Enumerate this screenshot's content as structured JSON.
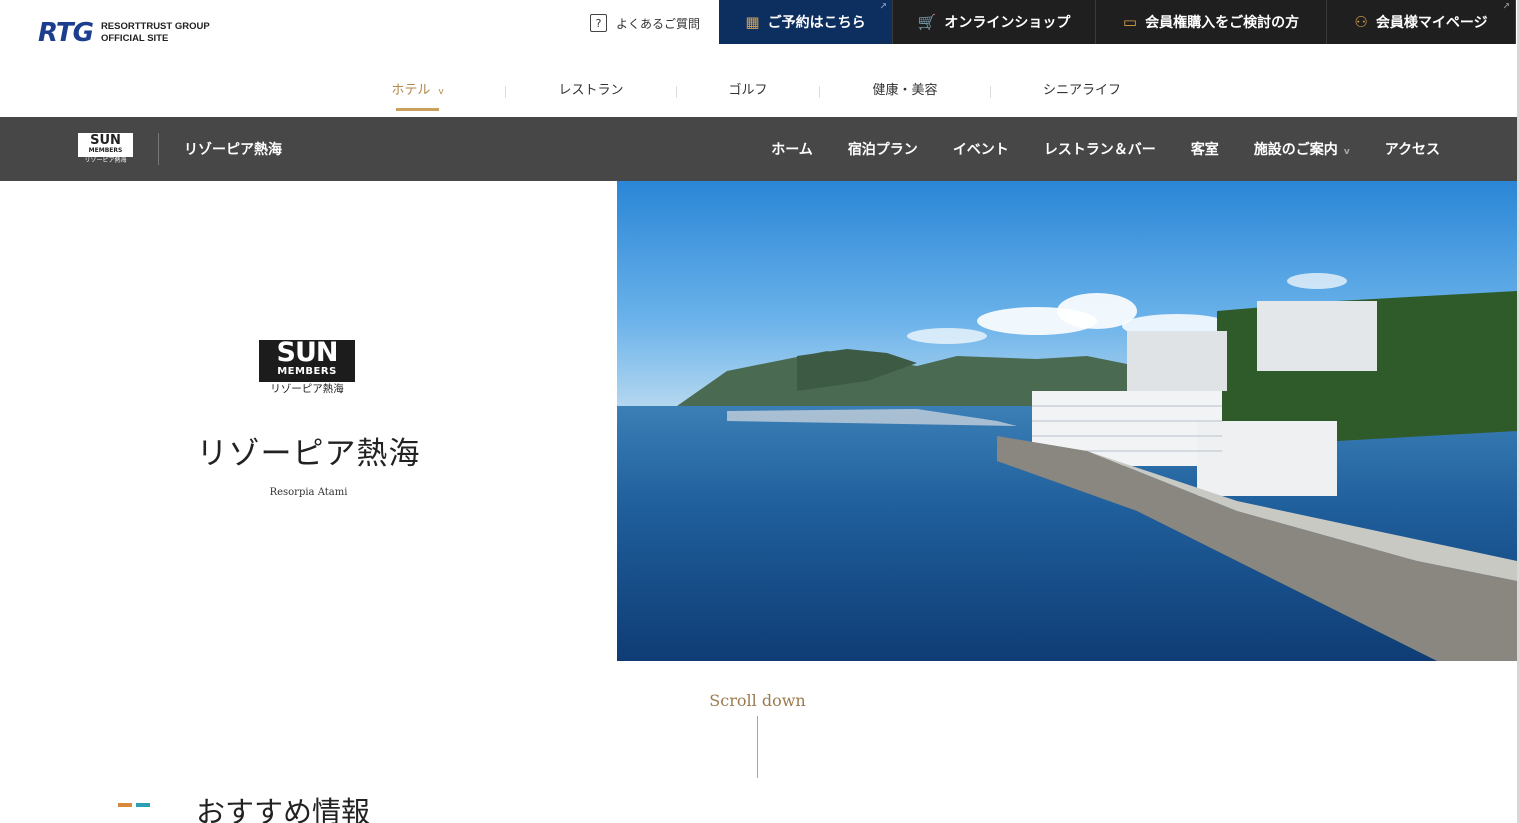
{
  "header": {
    "logo_mark": "RTG",
    "logo_line1": "RESORTTRUST GROUP",
    "logo_line2": "OFFICIAL SITE",
    "faq_label": "よくあるご質問",
    "buttons": {
      "reserve": "ご予約はこちら",
      "shop": "オンラインショップ",
      "membership": "会員権購入をご検討の方",
      "mypage": "会員様マイページ"
    },
    "categories": [
      {
        "label": "ホテル"
      },
      {
        "label": "レストラン"
      },
      {
        "label": "ゴルフ"
      },
      {
        "label": "健康・美容"
      },
      {
        "label": "シニアライフ"
      }
    ]
  },
  "subnav": {
    "brand_top": "SUN",
    "brand_mid": "MEMBERS",
    "brand_sub": "リゾーピア熱海",
    "title": "リゾーピア熱海",
    "items": [
      {
        "label": "ホーム"
      },
      {
        "label": "宿泊プラン"
      },
      {
        "label": "イベント"
      },
      {
        "label": "レストラン＆バー"
      },
      {
        "label": "客室"
      },
      {
        "label": "施設のご案内"
      },
      {
        "label": "アクセス"
      }
    ]
  },
  "hero": {
    "brand_top": "SUN",
    "brand_mid": "MEMBERS",
    "brand_sub": "リゾーピア熱海",
    "name": "リゾーピア熱海",
    "name_en": "Resorpia Atami"
  },
  "scroll_label": "Scroll down",
  "recommend_title": "おすすめ情報",
  "colors": {
    "navy": "#0d2f60",
    "gold": "#c9a15c",
    "dark_nav": "#474747",
    "accent_orange": "#d8893c",
    "accent_teal": "#2aa0b2"
  }
}
